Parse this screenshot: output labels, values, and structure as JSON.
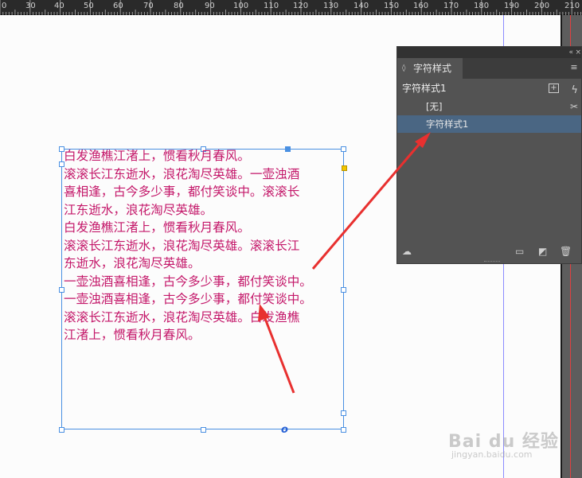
{
  "ruler": {
    "labels": [
      "0",
      "30",
      "40",
      "50",
      "60",
      "70",
      "80",
      "90",
      "100",
      "110",
      "120",
      "130",
      "140",
      "150",
      "160",
      "170",
      "180",
      "190",
      "200",
      "210"
    ]
  },
  "text_frame": {
    "lines": [
      "白发渔樵江渚上，惯看秋月春风。",
      "滚滚长江东逝水，浪花淘尽英雄。一壶浊酒",
      "喜相逢，古今多少事，都付笑谈中。滚滚长",
      "江东逝水，浪花淘尽英雄。",
      "白发渔樵江渚上，惯看秋月春风。",
      "滚滚长江东逝水，浪花淘尽英雄。滚滚长江",
      "东逝水，浪花淘尽英雄。",
      "一壶浊酒喜相逢，古今多少事，都付笑谈中。",
      "一壶浊酒喜相逢，古今多少事，都付笑谈中。",
      "滚滚长江东逝水，浪花淘尽英雄。白发渔樵",
      "江渚上，惯看秋月春风。"
    ],
    "overset_marker": "o",
    "text_color": "#c4186a"
  },
  "panel": {
    "collapse_label": "«",
    "close_label": "×",
    "tab_label": "字符样式",
    "tab_arrows": "◊",
    "menu_icon": "menu-icon",
    "header_title": "字符样式1",
    "styles": [
      {
        "label": "[无]",
        "selected": false
      },
      {
        "label": "字符样式1",
        "selected": true
      }
    ]
  },
  "watermark": {
    "text": "Bai du 经验",
    "sub": "jingyan.baidu.com"
  },
  "colors": {
    "frame_border": "#4a90e2",
    "arrow": "#e8302f",
    "panel_bg": "#535353",
    "selected_row": "#4a6683"
  }
}
